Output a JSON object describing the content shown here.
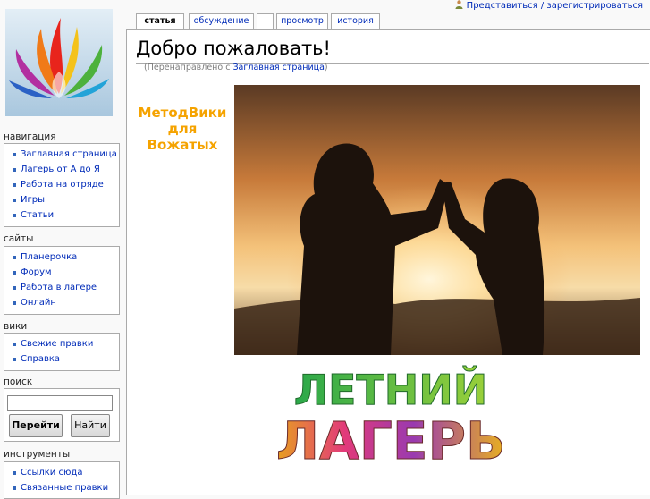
{
  "header": {
    "personal_link": "Представиться / зарегистрироваться"
  },
  "tabs": [
    {
      "label": "статья",
      "selected": true
    },
    {
      "label": "обсуждение",
      "selected": false
    },
    {
      "label": "",
      "selected": false
    },
    {
      "label": "просмотр",
      "selected": false
    },
    {
      "label": "история",
      "selected": false
    }
  ],
  "page": {
    "title": "Добро пожаловать!",
    "redirect_prefix": "(Перенаправлено с ",
    "redirect_link": "Заглавная страница",
    "redirect_suffix": ")",
    "methods_line1": "МетодВики",
    "methods_line2": "для",
    "methods_line3": "Вожатых",
    "camp_line1": "ЛЕТНИЙ",
    "camp_line2": "ЛАГЕРЬ"
  },
  "sidebar": {
    "navigation": {
      "title": "навигация",
      "items": [
        "Заглавная страница",
        "Лагерь от А до Я",
        "Работа на отряде",
        "Игры",
        "Статьи"
      ]
    },
    "sites": {
      "title": "сайты",
      "items": [
        "Планерочка",
        "Форум",
        "Работа в лагере",
        "Онлайн"
      ]
    },
    "wiki": {
      "title": "вики",
      "items": [
        "Свежие правки",
        "Справка"
      ]
    },
    "search": {
      "title": "поиск",
      "go_label": "Перейти",
      "find_label": "Найти",
      "value": ""
    },
    "tools": {
      "title": "инструменты",
      "items": [
        "Ссылки сюда",
        "Связанные правки"
      ]
    }
  },
  "colors": {
    "link": "#002bb8",
    "methods_title": "#f5a300",
    "camp_green": "#3bb34a"
  }
}
